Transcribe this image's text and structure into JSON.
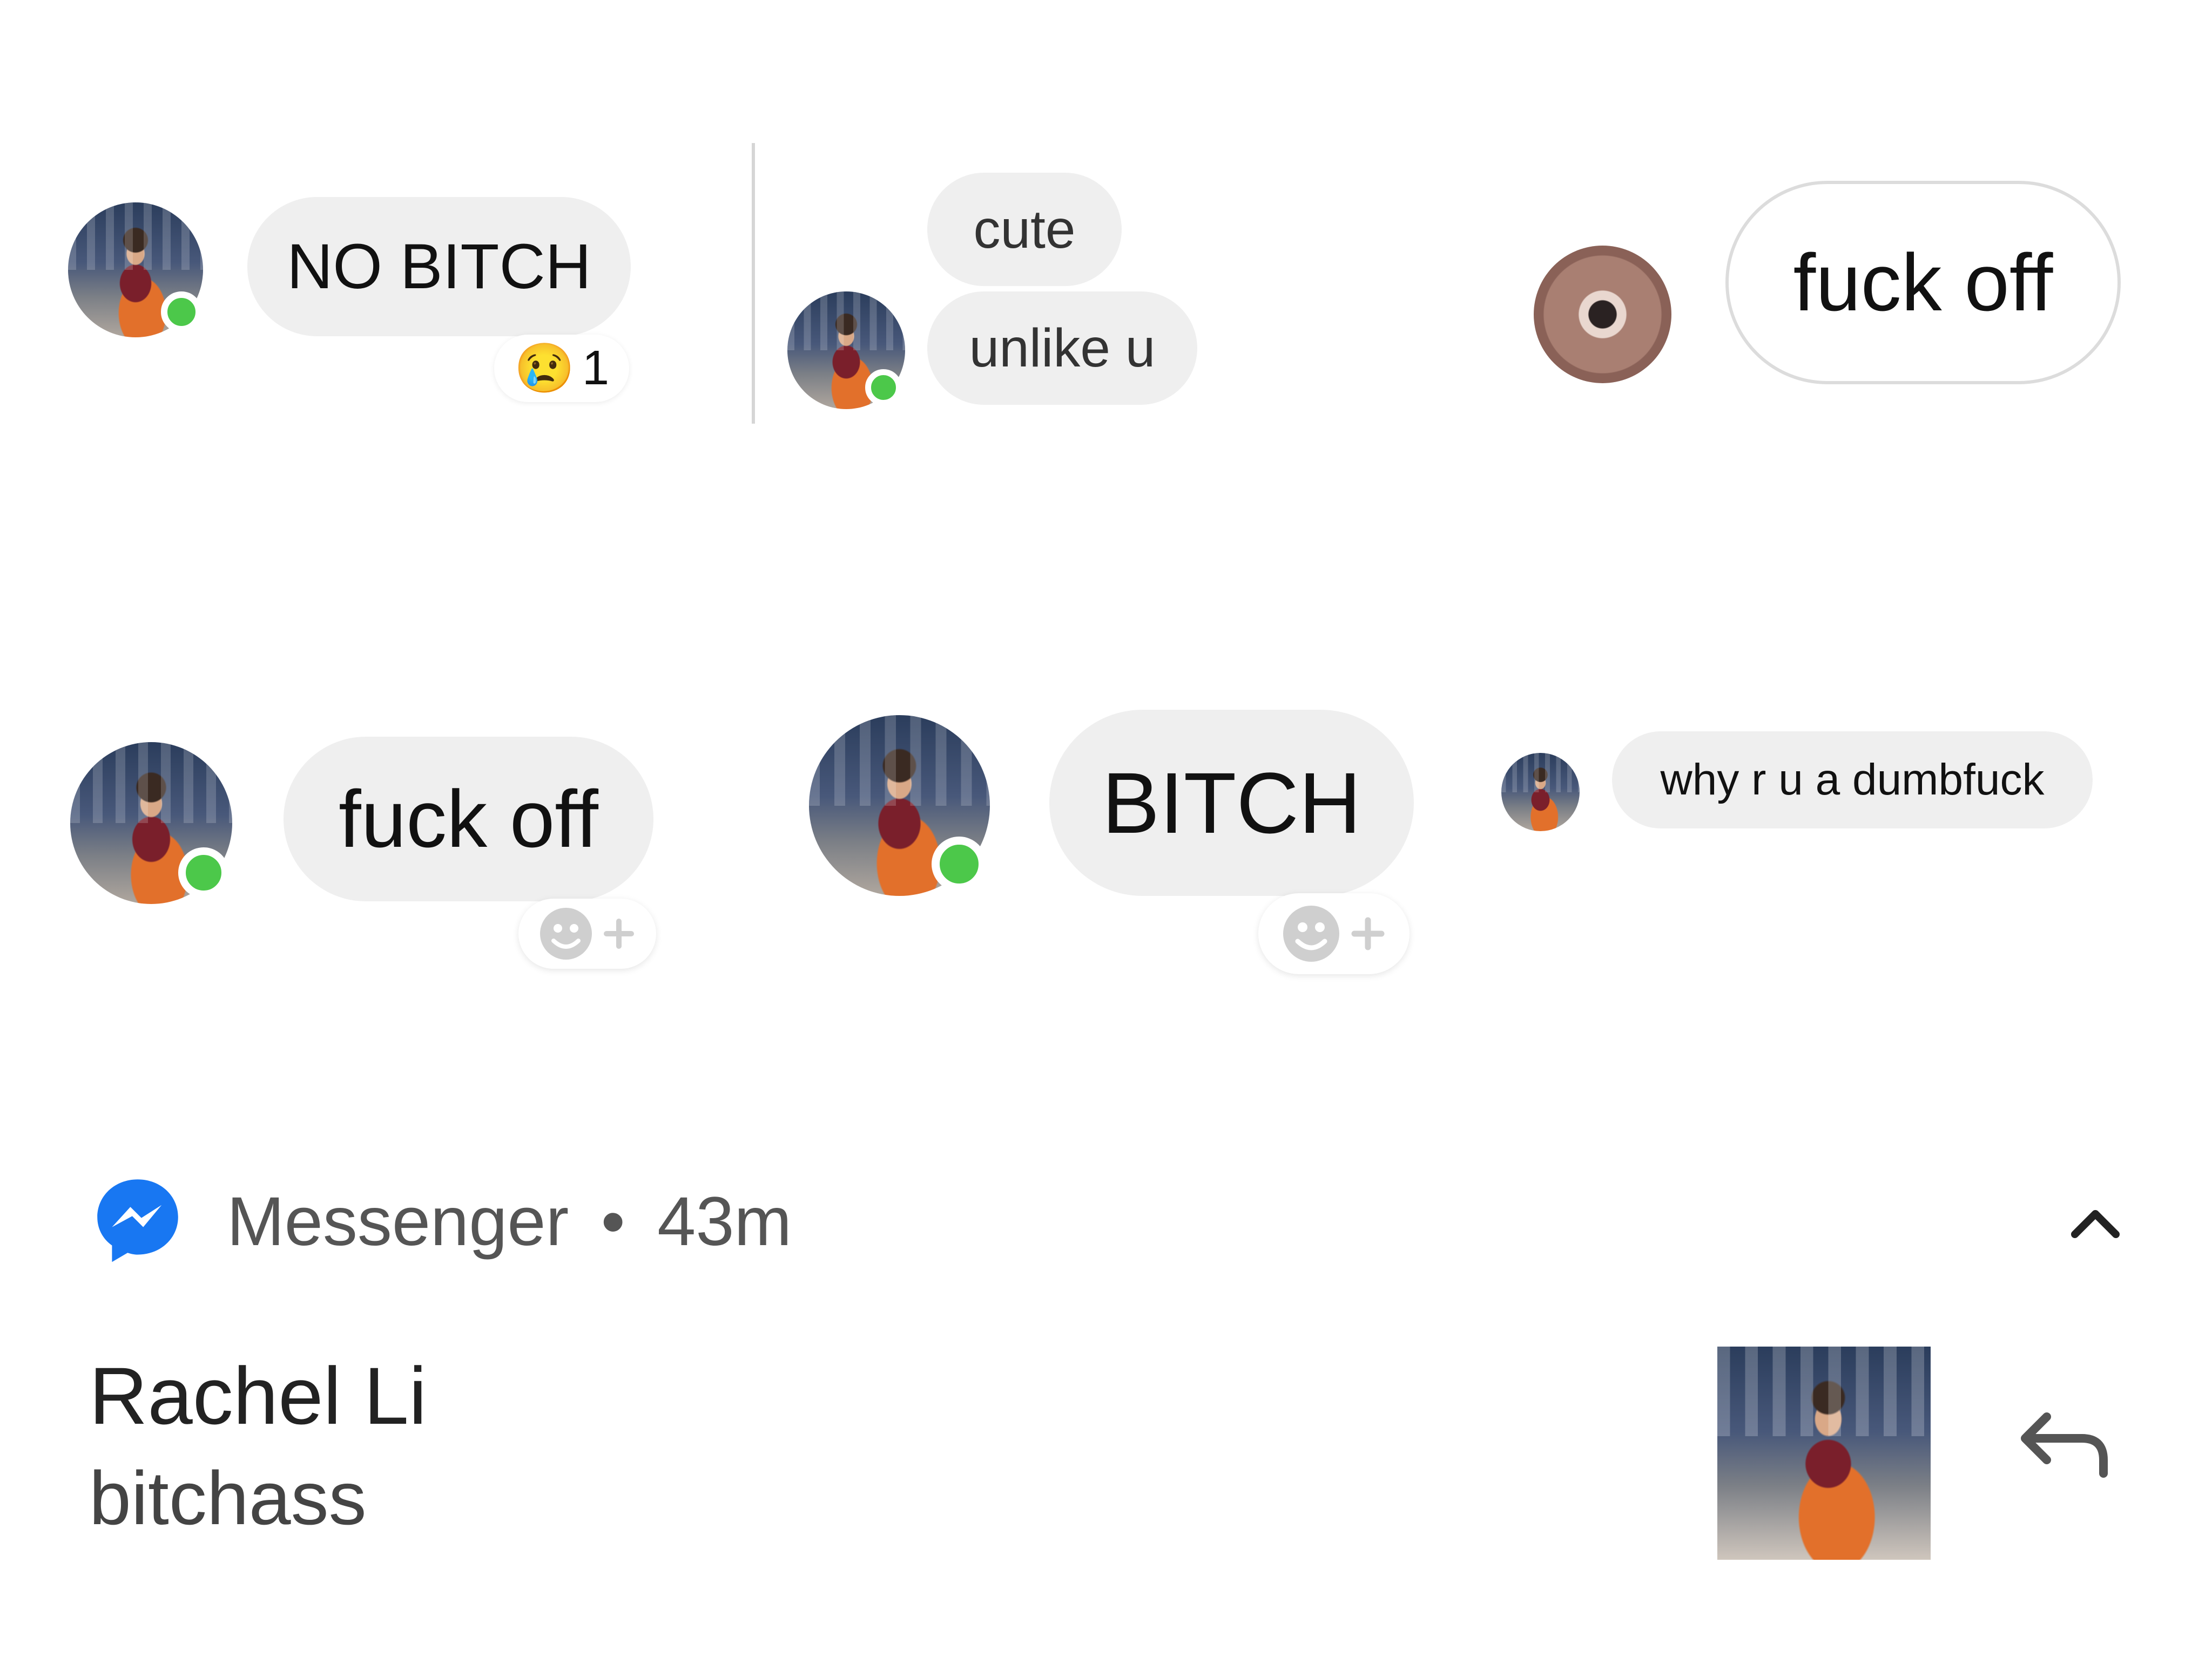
{
  "panel1": {
    "message": "NO BITCH",
    "reaction_emoji": "😢",
    "reaction_count": "1"
  },
  "panel2": {
    "messages": [
      "cute",
      "unlike u"
    ]
  },
  "panel3": {
    "message": "fuck off"
  },
  "panel4": {
    "message": "fuck off"
  },
  "panel5": {
    "message": "BITCH"
  },
  "panel6": {
    "message": "why r u a dumbfuck"
  },
  "notification": {
    "app_name": "Messenger",
    "separator": "•",
    "time_ago": "43m",
    "sender": "Rachel Li",
    "body": "bitchass"
  },
  "colors": {
    "online": "#4cc84a",
    "bubble": "#efefef",
    "messenger_blue": "#1877f2"
  },
  "icons": [
    "messenger-icon",
    "collapse-chevron-icon",
    "reply-icon",
    "add-reaction-icon",
    "crying-emoji-icon"
  ]
}
